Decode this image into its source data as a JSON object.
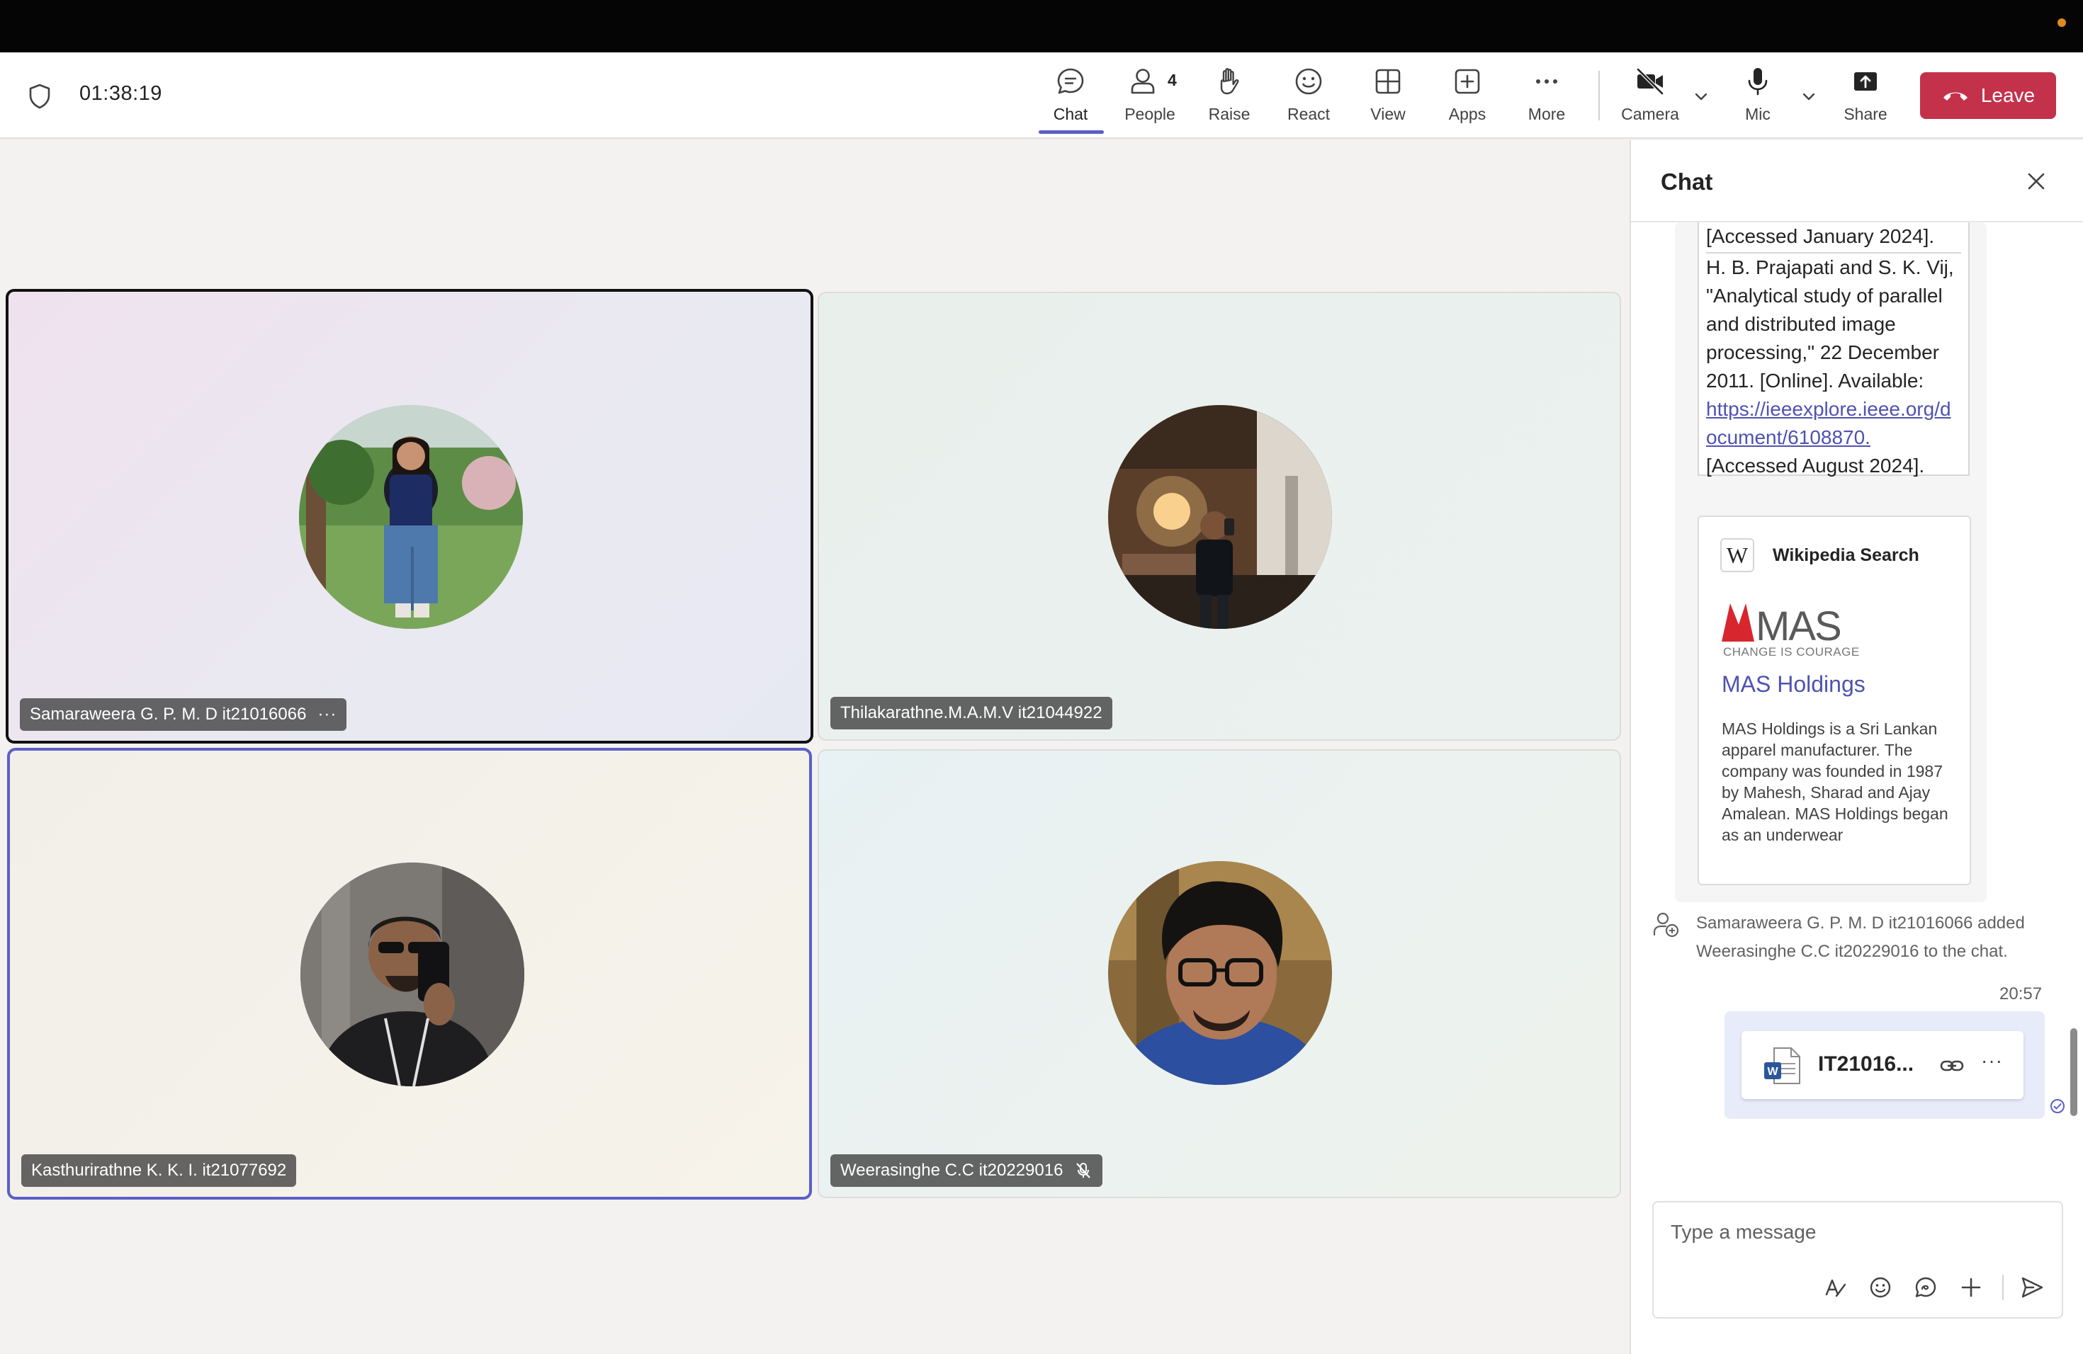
{
  "meeting": {
    "elapsed_time": "01:38:19"
  },
  "toolbar": {
    "chat_label": "Chat",
    "people_label": "People",
    "people_count": "4",
    "raise_label": "Raise",
    "react_label": "React",
    "view_label": "View",
    "apps_label": "Apps",
    "more_label": "More",
    "camera_label": "Camera",
    "mic_label": "Mic",
    "share_label": "Share",
    "leave_label": "Leave"
  },
  "participants": [
    {
      "name": "Samaraweera G. P. M. D it21016066",
      "pinned": true,
      "more_menu": true
    },
    {
      "name": "Thilakarathne.M.A.M.V it21044922"
    },
    {
      "name": "Kasthurirathne K. K. I. it21077692",
      "speaking": true
    },
    {
      "name": "Weerasinghe C.C it20229016",
      "muted": true
    }
  ],
  "chat": {
    "title": "Chat",
    "reference_box": {
      "line1": "[Accessed January 2024].",
      "citation": "H. B. Prajapati and S. K. Vij, \"Analytical study of parallel and distributed image processing,\" 22 December 2011. [Online]. Available:",
      "link": "https://ieeexplore.ieee.org/document/6108870.",
      "accessed": "[Accessed August 2024]."
    },
    "wiki_card": {
      "source": "Wikipedia Search",
      "logo_text": "MAS",
      "logo_tagline": "CHANGE IS COURAGE",
      "title": "MAS Holdings",
      "description": "MAS Holdings is a Sri Lankan apparel manufacturer. The company was founded in 1987 by Mahesh, Sharad and Ajay Amalean. MAS Holdings began as an underwear"
    },
    "system_message": "Samaraweera G. P. M. D it21016066 added Weerasinghe C.C it20229016 to the chat.",
    "my_message": {
      "time": "20:57",
      "file_name": "IT21016..."
    },
    "compose_placeholder": "Type a message"
  },
  "colors": {
    "accent": "#5b5fc7",
    "leave": "#c4314b",
    "link": "#4f52b2",
    "my_message_bg": "#e8ebfa"
  },
  "icons": [
    "shield-icon",
    "chat-icon",
    "people-icon",
    "hand-icon",
    "smile-icon",
    "grid-icon",
    "plus-square-icon",
    "ellipsis-icon",
    "camera-off-icon",
    "chevron-down-icon",
    "microphone-icon",
    "share-icon",
    "phone-hangup-icon",
    "close-icon",
    "wikipedia-icon",
    "person-add-icon",
    "word-file-icon",
    "link-icon",
    "check-circle-icon",
    "format-icon",
    "emoji-icon",
    "loop-icon",
    "plus-icon",
    "send-icon",
    "mic-off-icon"
  ]
}
